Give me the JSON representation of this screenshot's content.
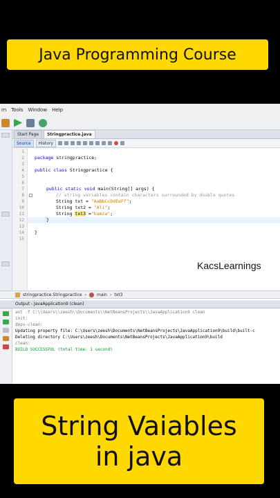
{
  "top_banner": {
    "text": "Java Programming Course"
  },
  "bottom_banner": {
    "line1": "String Vaiables",
    "line2": "in java"
  },
  "menu": [
    "rn",
    "Tools",
    "Window",
    "Help"
  ],
  "tabs": [
    "Start Page",
    "Stringpractice.java"
  ],
  "editor_tools": {
    "source": "Source",
    "history": "History"
  },
  "line_numbers": [
    "1",
    "2",
    "3",
    "4",
    "5",
    "6",
    "7",
    "8",
    "9",
    "10",
    "11",
    "12",
    "13",
    "14",
    "15"
  ],
  "code": {
    "line3_kw": "package",
    "line3_rest": " stringpractice;",
    "line5_kw": "public class",
    "line5_rest": " Stringpractice {",
    "line8_kw": "public static void",
    "line8_rest": " main(String[] args) {",
    "line9_comment": "// string variables contain characters surrounded by double quotes",
    "line10_a": "String txt = ",
    "line10_str": "\"AaBbCcDdEeFf\"",
    "line10_end": ";",
    "line11_a": "String txt2 = ",
    "line11_str": "\"Ali\"",
    "line11_end": ";",
    "line12_a": "String ",
    "line12_hl": "txt3",
    "line12_b": " =",
    "line12_str": "\"hamza\"",
    "line12_end": ";",
    "line13": "}",
    "line15": "}"
  },
  "breadcrumb": [
    "stringpractice.Stringpractice",
    "main",
    "txt3"
  ],
  "output_title": "Output - JavaApplication9 (clean)",
  "output_lines": [
    "ant -f C:\\\\Users\\\\zeesh\\\\Documents\\\\NetBeansProjects\\\\JavaApplication9 clean",
    "init:",
    "deps-clean:",
    "Updating property file: C:\\Users\\zeesh\\Documents\\NetBeansProjects\\JavaApplication9\\build\\built-c",
    "Deleting directory C:\\Users\\zeesh\\Documents\\NetBeansProjects\\JavaApplication9\\build",
    "clean:",
    "BUILD SUCCESSFUL (total time: 1 second)"
  ],
  "watermark": "KacsLearnings",
  "colors": {
    "banner": "#ffd800",
    "keyword": "#0000e6",
    "string": "#ce7b00",
    "comment": "#969696",
    "success": "#079a2e"
  }
}
